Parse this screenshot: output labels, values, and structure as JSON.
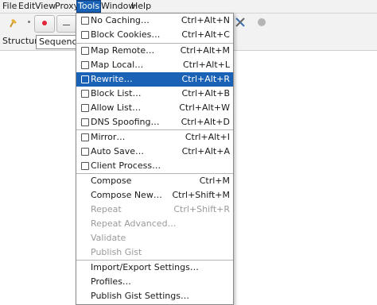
{
  "menubar": {
    "items": [
      "File",
      "Edit",
      "View",
      "Proxy",
      "Tools",
      "Window",
      "Help"
    ],
    "active": "Tools"
  },
  "toolbar": {
    "icons": [
      "broom-icon",
      "record-icon",
      "throttle-icon",
      "tools-icon",
      "settings-icon"
    ]
  },
  "tabs": {
    "structure": "Structure",
    "sequence": "Sequence"
  },
  "tools_menu": {
    "items": [
      {
        "label": "No Caching…",
        "shortcut": "Ctrl+Alt+N"
      },
      {
        "label": "Block Cookies…",
        "shortcut": "Ctrl+Alt+C"
      },
      {
        "label": "Map Remote…",
        "shortcut": "Ctrl+Alt+M"
      },
      {
        "label": "Map Local…",
        "shortcut": "Ctrl+Alt+L"
      },
      {
        "label": "Rewrite…",
        "shortcut": "Ctrl+Alt+R"
      },
      {
        "label": "Block List…",
        "shortcut": "Ctrl+Alt+B"
      },
      {
        "label": "Allow List…",
        "shortcut": "Ctrl+Alt+W"
      },
      {
        "label": "DNS Spoofing…",
        "shortcut": "Ctrl+Alt+D"
      },
      {
        "label": "Mirror…",
        "shortcut": "Ctrl+Alt+I"
      },
      {
        "label": "Auto Save…",
        "shortcut": "Ctrl+Alt+A"
      },
      {
        "label": "Client Process…",
        "shortcut": ""
      },
      {
        "label": "Compose",
        "shortcut": "Ctrl+M"
      },
      {
        "label": "Compose New…",
        "shortcut": "Ctrl+Shift+M"
      },
      {
        "label": "Repeat",
        "shortcut": "Ctrl+Shift+R"
      },
      {
        "label": "Repeat Advanced…",
        "shortcut": ""
      },
      {
        "label": "Validate",
        "shortcut": ""
      },
      {
        "label": "Publish Gist",
        "shortcut": ""
      },
      {
        "label": "Import/Export Settings…",
        "shortcut": ""
      },
      {
        "label": "Profiles…",
        "shortcut": ""
      },
      {
        "label": "Publish Gist Settings…",
        "shortcut": ""
      }
    ],
    "highlighted": "Rewrite…"
  },
  "colors": {
    "highlight": "#1a62b5",
    "disabled_text": "#9a9a9a",
    "record_red": "#e0243a"
  }
}
